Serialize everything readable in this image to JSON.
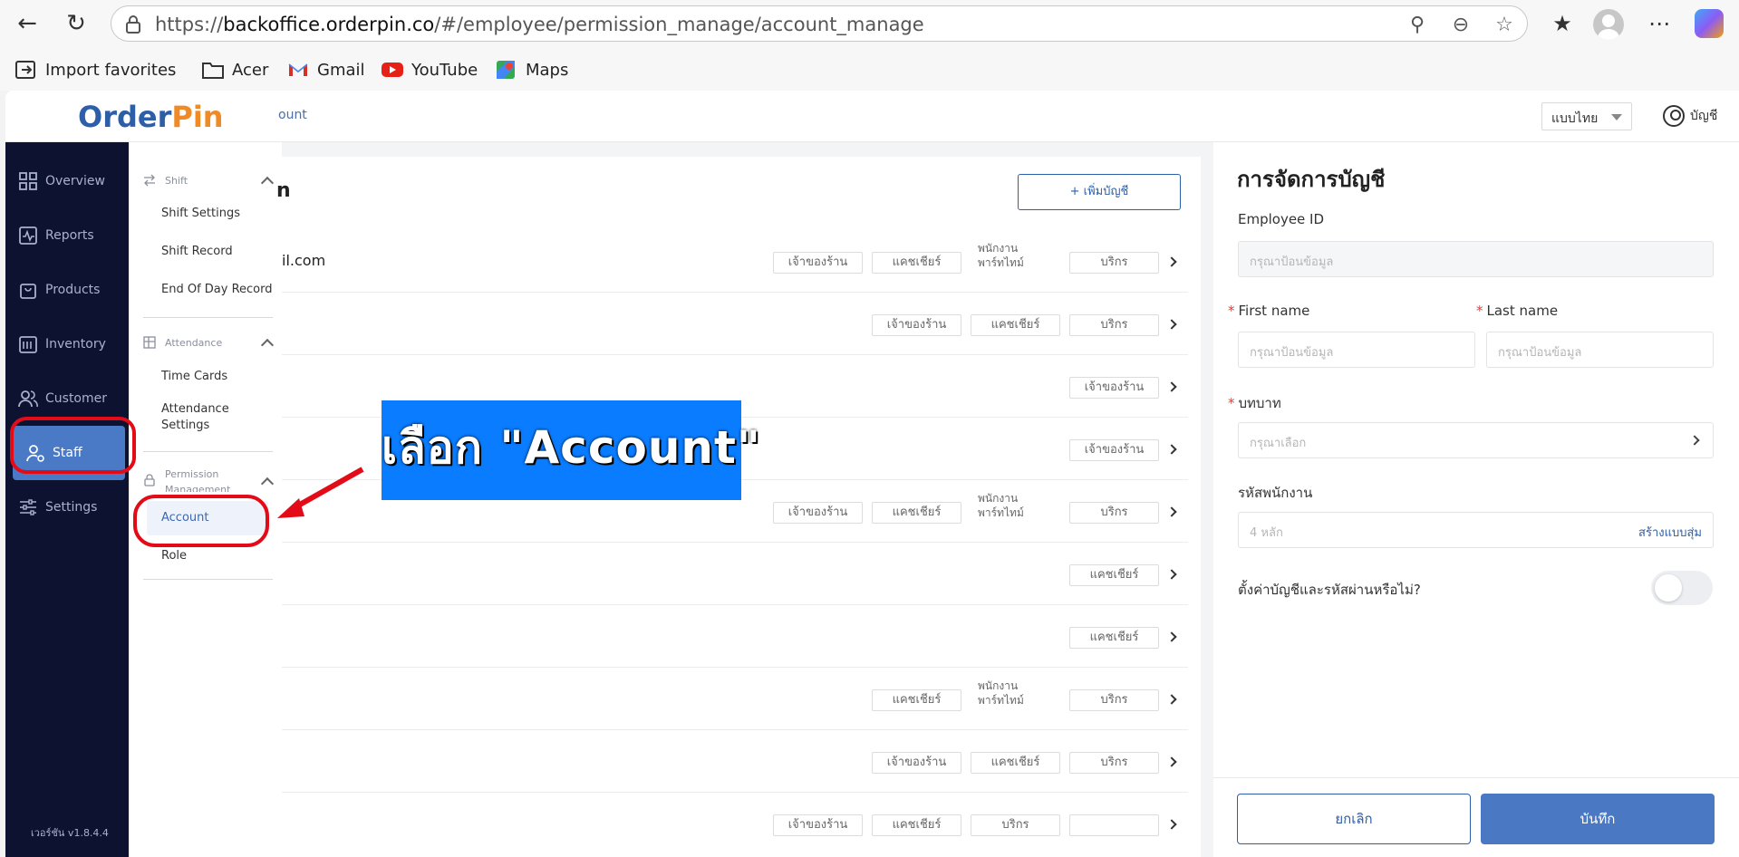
{
  "browser": {
    "url_prefix": "https://",
    "url_host": "backoffice.orderpin.co",
    "url_path": "/#/employee/permission_manage/account_manage",
    "favorites": [
      {
        "label": "Import favorites",
        "icon": "import-icon"
      },
      {
        "label": "Acer",
        "icon": "folder-icon"
      },
      {
        "label": "Gmail",
        "icon": "gmail-icon"
      },
      {
        "label": "YouTube",
        "icon": "youtube-icon"
      },
      {
        "label": "Maps",
        "icon": "maps-icon"
      }
    ]
  },
  "header": {
    "logo_a": "Order",
    "logo_b": "Pin",
    "breadcrumb": "ount",
    "language": "แบบไทย",
    "account": "บัญชี"
  },
  "sidebar": {
    "items": [
      {
        "label": "Overview",
        "icon": "grid-icon"
      },
      {
        "label": "Reports",
        "icon": "chart-icon"
      },
      {
        "label": "Products",
        "icon": "bag-icon"
      },
      {
        "label": "Inventory",
        "icon": "box-icon"
      },
      {
        "label": "Customer",
        "icon": "users-icon"
      },
      {
        "label": "Staff",
        "icon": "staff-icon"
      },
      {
        "label": "Settings",
        "icon": "sliders-icon"
      }
    ],
    "active": "Staff",
    "version": "เวอร์ชัน v1.8.4.4"
  },
  "submenu": {
    "shift_header": "Shift",
    "shift_items": [
      "Shift Settings",
      "Shift Record",
      "End Of Day Record"
    ],
    "attendance_header": "Attendance",
    "attendance_items": [
      "Time Cards",
      "Attendance Settings"
    ],
    "permission_header": "Permission Management",
    "permission_items": [
      "Account",
      "Role"
    ],
    "active": "Account"
  },
  "list": {
    "title": "n",
    "add_button": "+ เพิ่มบัญชี",
    "rows": [
      {
        "name": "il.com",
        "tags": [
          "เจ้าของร้าน",
          "แคชเชียร์",
          "พนักงานพาร์ทไทม์",
          "บริกร"
        ]
      },
      {
        "name": "",
        "tags": [
          "เจ้าของร้าน",
          "แคชเชียร์",
          "บริกร"
        ]
      },
      {
        "name": "",
        "tags": [
          "เจ้าของร้าน"
        ]
      },
      {
        "name": "",
        "tags": [
          "เจ้าของร้าน"
        ]
      },
      {
        "name": "",
        "tags": [
          "เจ้าของร้าน",
          "แคชเชียร์",
          "พนักงานพาร์ทไทม์",
          "บริกร"
        ]
      },
      {
        "name": "",
        "tags": [
          "แคชเชียร์"
        ]
      },
      {
        "name": "",
        "tags": [
          "แคชเชียร์"
        ]
      },
      {
        "name": "",
        "tags": [
          "แคชเชียร์",
          "พนักงานพาร์ทไทม์",
          "บริกร"
        ]
      },
      {
        "name": "",
        "tags": [
          "เจ้าของร้าน",
          "แคชเชียร์",
          "บริกร"
        ]
      },
      {
        "name": "",
        "tags": [
          "เจ้าของร้าน",
          "แคชเชียร์",
          "บริกร",
          ""
        ]
      }
    ]
  },
  "annotation": {
    "banner": "เลือก \"Account\""
  },
  "form": {
    "title": "การจัดการบัญชี",
    "employee_id_label": "Employee ID",
    "employee_id_placeholder": "กรุณาป้อนข้อมูล",
    "first_name_label": "First name",
    "first_name_placeholder": "กรุณาป้อนข้อมูล",
    "last_name_label": "Last name",
    "last_name_placeholder": "กรุณาป้อนข้อมูล",
    "role_label": "บทบาท",
    "role_placeholder": "กรุณาเลือก",
    "code_label": "รหัสพนักงาน",
    "code_placeholder": "4 หลัก",
    "code_generate": "สร้างแบบสุ่ม",
    "toggle_label": "ตั้งค่าบัญชีและรหัสผ่านหรือไม่?",
    "cancel": "ยกเลิก",
    "save": "บันทึก"
  }
}
